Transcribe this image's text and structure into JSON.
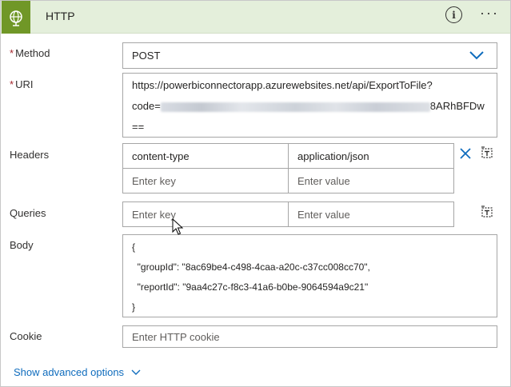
{
  "header": {
    "title": "HTTP",
    "icon": "globe-icon",
    "info_icon": "info-icon",
    "info_glyph": "i",
    "more_icon": "more-icon",
    "more_glyph": "···",
    "accent": "#709727",
    "background": "#e4efdb"
  },
  "method": {
    "required_mark": "*",
    "label": "Method",
    "value": "POST"
  },
  "uri": {
    "required_mark": "*",
    "label": "URI",
    "line1": "https://powerbiconnectorapp.azurewebsites.net/api/ExportToFile?",
    "line2_prefix": "code=",
    "line2_suffix": "8ARhBFDw",
    "line3": "=="
  },
  "headers": {
    "label": "Headers",
    "rows": [
      {
        "key": "content-type",
        "value": "application/json"
      }
    ],
    "key_placeholder": "Enter key",
    "value_placeholder": "Enter value"
  },
  "queries": {
    "label": "Queries",
    "key_placeholder": "Enter key",
    "value_placeholder": "Enter value"
  },
  "body": {
    "label": "Body",
    "lines": [
      "{",
      "  \"groupId\": \"8ac69be4-c498-4caa-a20c-c37cc008cc70\",",
      "  \"reportId\": \"9aa4c27c-f8c3-41a6-b0be-9064594a9c21\"",
      "}"
    ]
  },
  "cookie": {
    "label": "Cookie",
    "placeholder": "Enter HTTP cookie"
  },
  "advanced": {
    "label": "Show advanced options",
    "link_color": "#0f6cbd"
  }
}
